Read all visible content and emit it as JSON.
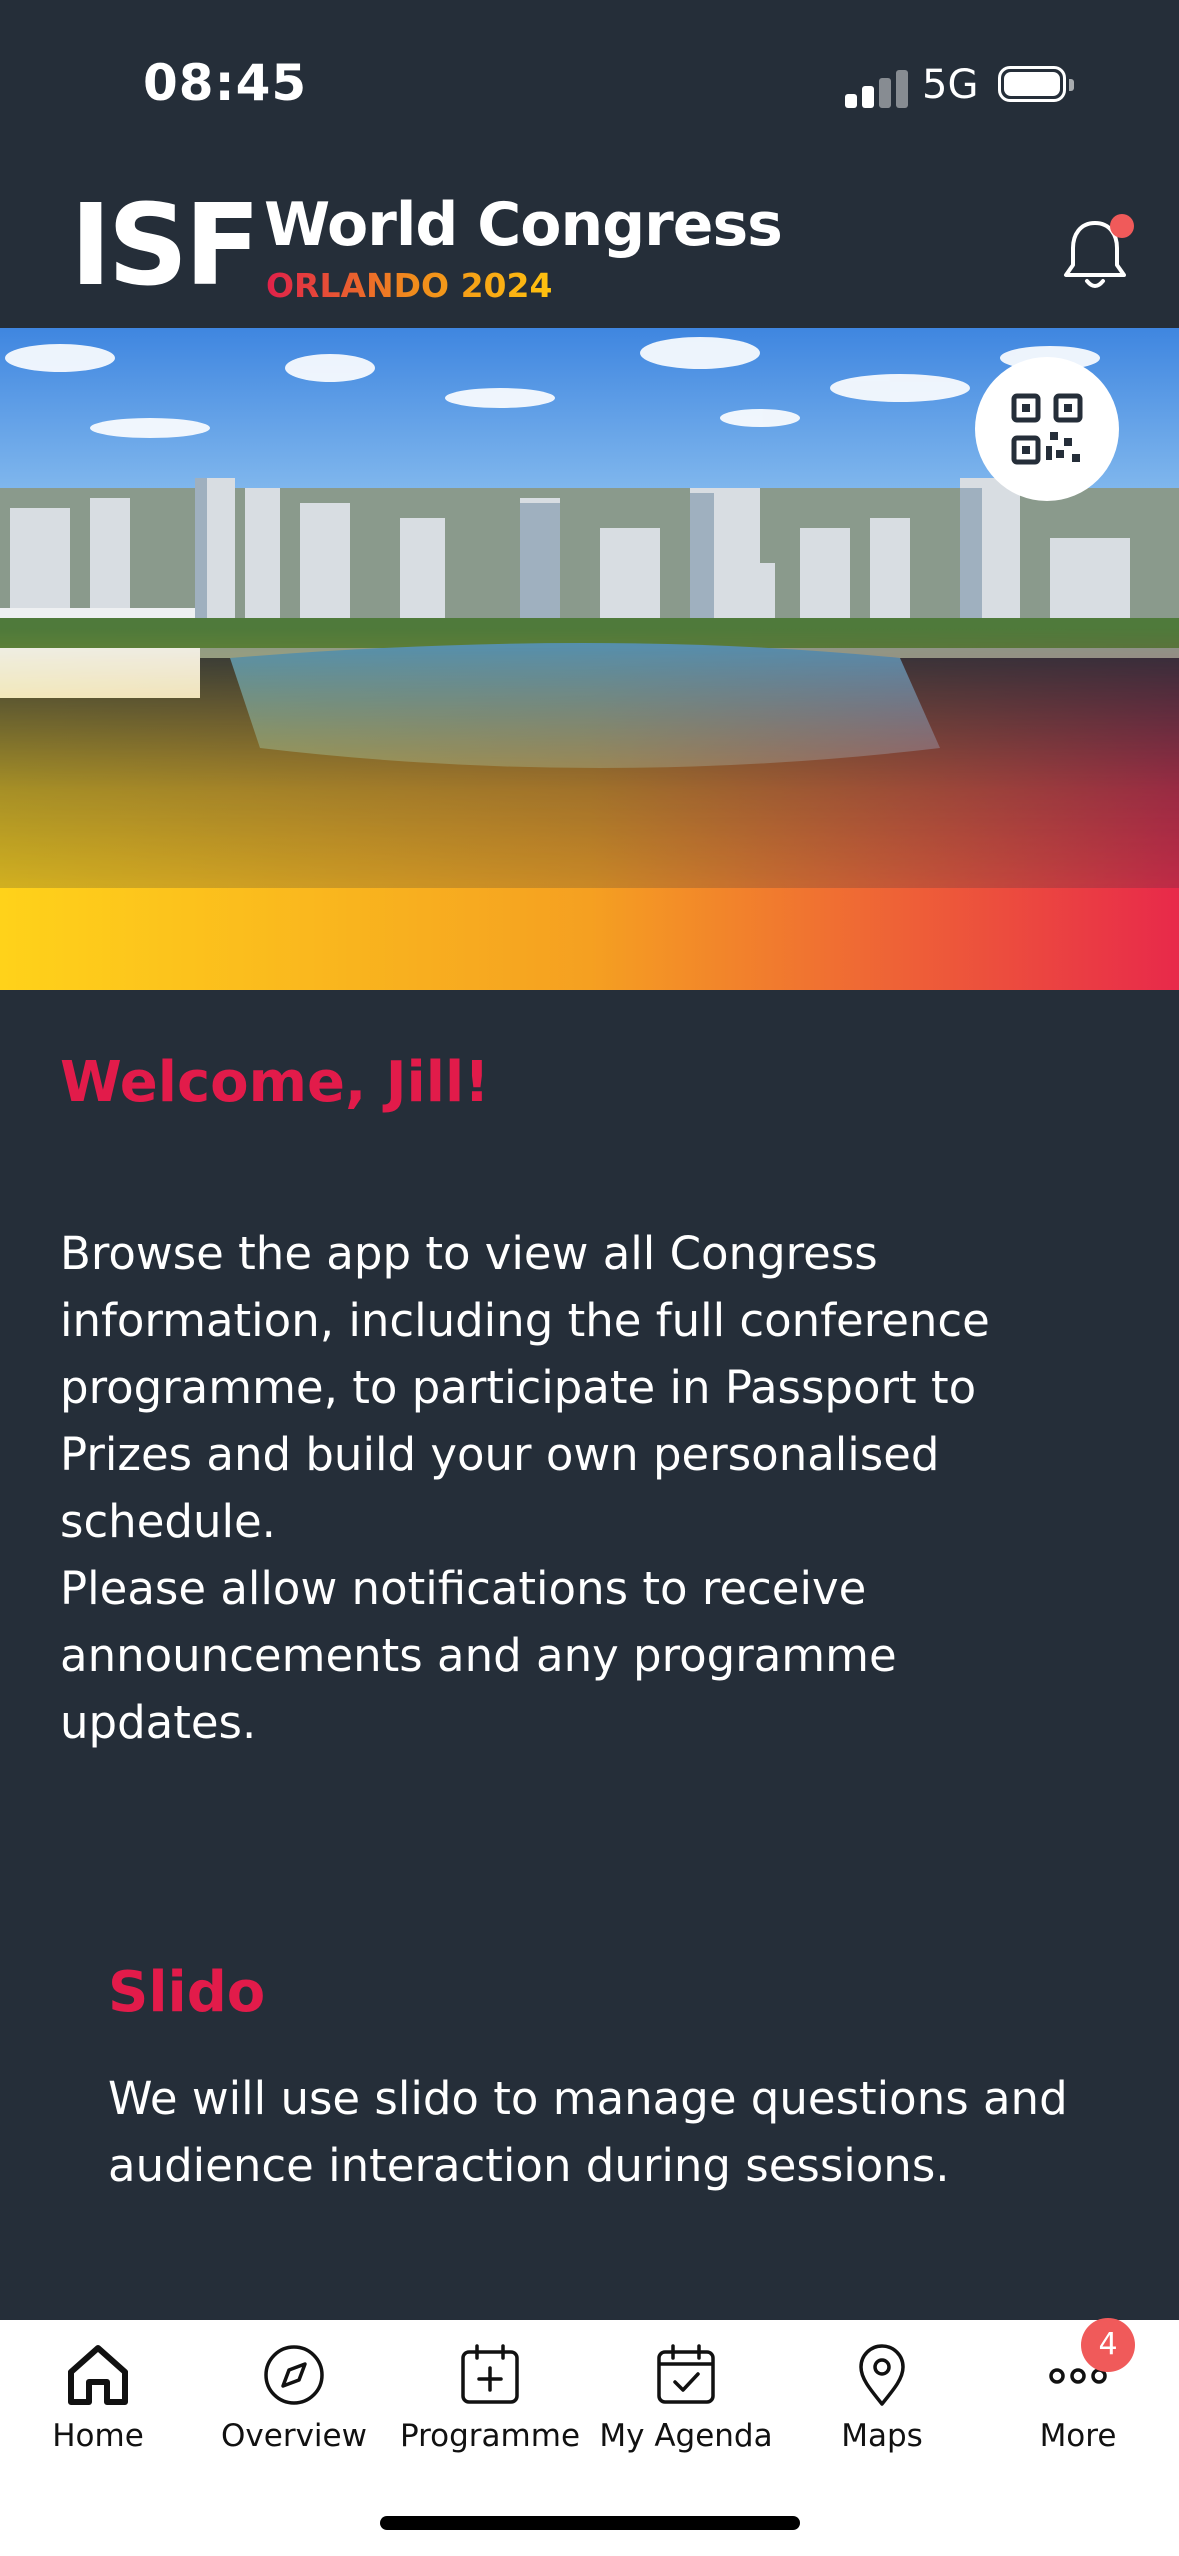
{
  "status_bar": {
    "time": "08:45",
    "network": "5G"
  },
  "header": {
    "logo_mark": "ISF",
    "title": "World Congress",
    "subtitle": "ORLANDO 2024",
    "bell_icon": "bell-icon"
  },
  "hero": {
    "qr_icon": "qr-code-icon"
  },
  "welcome": {
    "heading": "Welcome, Jill!",
    "body": "Browse the app to view all Congress\ninformation, including the full conference\nprogramme, to participate in Passport to\nPrizes and build your own personalised\nschedule.\nPlease allow notifications to receive\nannouncements and any programme\nupdates."
  },
  "slido": {
    "heading": "Slido",
    "body": "We will use slido to manage questions\nand audience interaction during\nsessions."
  },
  "tabbar": {
    "items": [
      {
        "label": "Home",
        "icon": "home-icon"
      },
      {
        "label": "Overview",
        "icon": "compass-icon"
      },
      {
        "label": "Programme",
        "icon": "calendar-plus-icon"
      },
      {
        "label": "My Agenda",
        "icon": "calendar-check-icon"
      },
      {
        "label": "Maps",
        "icon": "map-pin-icon"
      },
      {
        "label": "More",
        "icon": "more-dots-icon",
        "badge": "4"
      }
    ]
  },
  "colors": {
    "background": "#252e39",
    "accent": "#e21b4a",
    "badge": "#f05a5a"
  }
}
